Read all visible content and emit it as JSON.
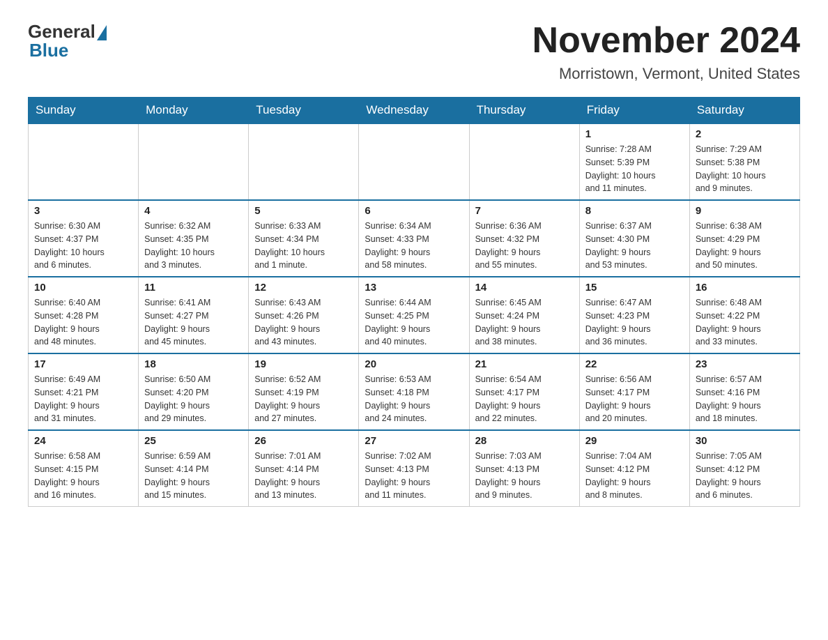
{
  "header": {
    "logo_general": "General",
    "logo_blue": "Blue",
    "title": "November 2024",
    "subtitle": "Morristown, Vermont, United States"
  },
  "weekdays": [
    "Sunday",
    "Monday",
    "Tuesday",
    "Wednesday",
    "Thursday",
    "Friday",
    "Saturday"
  ],
  "weeks": [
    [
      {
        "day": "",
        "info": ""
      },
      {
        "day": "",
        "info": ""
      },
      {
        "day": "",
        "info": ""
      },
      {
        "day": "",
        "info": ""
      },
      {
        "day": "",
        "info": ""
      },
      {
        "day": "1",
        "info": "Sunrise: 7:28 AM\nSunset: 5:39 PM\nDaylight: 10 hours\nand 11 minutes."
      },
      {
        "day": "2",
        "info": "Sunrise: 7:29 AM\nSunset: 5:38 PM\nDaylight: 10 hours\nand 9 minutes."
      }
    ],
    [
      {
        "day": "3",
        "info": "Sunrise: 6:30 AM\nSunset: 4:37 PM\nDaylight: 10 hours\nand 6 minutes."
      },
      {
        "day": "4",
        "info": "Sunrise: 6:32 AM\nSunset: 4:35 PM\nDaylight: 10 hours\nand 3 minutes."
      },
      {
        "day": "5",
        "info": "Sunrise: 6:33 AM\nSunset: 4:34 PM\nDaylight: 10 hours\nand 1 minute."
      },
      {
        "day": "6",
        "info": "Sunrise: 6:34 AM\nSunset: 4:33 PM\nDaylight: 9 hours\nand 58 minutes."
      },
      {
        "day": "7",
        "info": "Sunrise: 6:36 AM\nSunset: 4:32 PM\nDaylight: 9 hours\nand 55 minutes."
      },
      {
        "day": "8",
        "info": "Sunrise: 6:37 AM\nSunset: 4:30 PM\nDaylight: 9 hours\nand 53 minutes."
      },
      {
        "day": "9",
        "info": "Sunrise: 6:38 AM\nSunset: 4:29 PM\nDaylight: 9 hours\nand 50 minutes."
      }
    ],
    [
      {
        "day": "10",
        "info": "Sunrise: 6:40 AM\nSunset: 4:28 PM\nDaylight: 9 hours\nand 48 minutes."
      },
      {
        "day": "11",
        "info": "Sunrise: 6:41 AM\nSunset: 4:27 PM\nDaylight: 9 hours\nand 45 minutes."
      },
      {
        "day": "12",
        "info": "Sunrise: 6:43 AM\nSunset: 4:26 PM\nDaylight: 9 hours\nand 43 minutes."
      },
      {
        "day": "13",
        "info": "Sunrise: 6:44 AM\nSunset: 4:25 PM\nDaylight: 9 hours\nand 40 minutes."
      },
      {
        "day": "14",
        "info": "Sunrise: 6:45 AM\nSunset: 4:24 PM\nDaylight: 9 hours\nand 38 minutes."
      },
      {
        "day": "15",
        "info": "Sunrise: 6:47 AM\nSunset: 4:23 PM\nDaylight: 9 hours\nand 36 minutes."
      },
      {
        "day": "16",
        "info": "Sunrise: 6:48 AM\nSunset: 4:22 PM\nDaylight: 9 hours\nand 33 minutes."
      }
    ],
    [
      {
        "day": "17",
        "info": "Sunrise: 6:49 AM\nSunset: 4:21 PM\nDaylight: 9 hours\nand 31 minutes."
      },
      {
        "day": "18",
        "info": "Sunrise: 6:50 AM\nSunset: 4:20 PM\nDaylight: 9 hours\nand 29 minutes."
      },
      {
        "day": "19",
        "info": "Sunrise: 6:52 AM\nSunset: 4:19 PM\nDaylight: 9 hours\nand 27 minutes."
      },
      {
        "day": "20",
        "info": "Sunrise: 6:53 AM\nSunset: 4:18 PM\nDaylight: 9 hours\nand 24 minutes."
      },
      {
        "day": "21",
        "info": "Sunrise: 6:54 AM\nSunset: 4:17 PM\nDaylight: 9 hours\nand 22 minutes."
      },
      {
        "day": "22",
        "info": "Sunrise: 6:56 AM\nSunset: 4:17 PM\nDaylight: 9 hours\nand 20 minutes."
      },
      {
        "day": "23",
        "info": "Sunrise: 6:57 AM\nSunset: 4:16 PM\nDaylight: 9 hours\nand 18 minutes."
      }
    ],
    [
      {
        "day": "24",
        "info": "Sunrise: 6:58 AM\nSunset: 4:15 PM\nDaylight: 9 hours\nand 16 minutes."
      },
      {
        "day": "25",
        "info": "Sunrise: 6:59 AM\nSunset: 4:14 PM\nDaylight: 9 hours\nand 15 minutes."
      },
      {
        "day": "26",
        "info": "Sunrise: 7:01 AM\nSunset: 4:14 PM\nDaylight: 9 hours\nand 13 minutes."
      },
      {
        "day": "27",
        "info": "Sunrise: 7:02 AM\nSunset: 4:13 PM\nDaylight: 9 hours\nand 11 minutes."
      },
      {
        "day": "28",
        "info": "Sunrise: 7:03 AM\nSunset: 4:13 PM\nDaylight: 9 hours\nand 9 minutes."
      },
      {
        "day": "29",
        "info": "Sunrise: 7:04 AM\nSunset: 4:12 PM\nDaylight: 9 hours\nand 8 minutes."
      },
      {
        "day": "30",
        "info": "Sunrise: 7:05 AM\nSunset: 4:12 PM\nDaylight: 9 hours\nand 6 minutes."
      }
    ]
  ]
}
